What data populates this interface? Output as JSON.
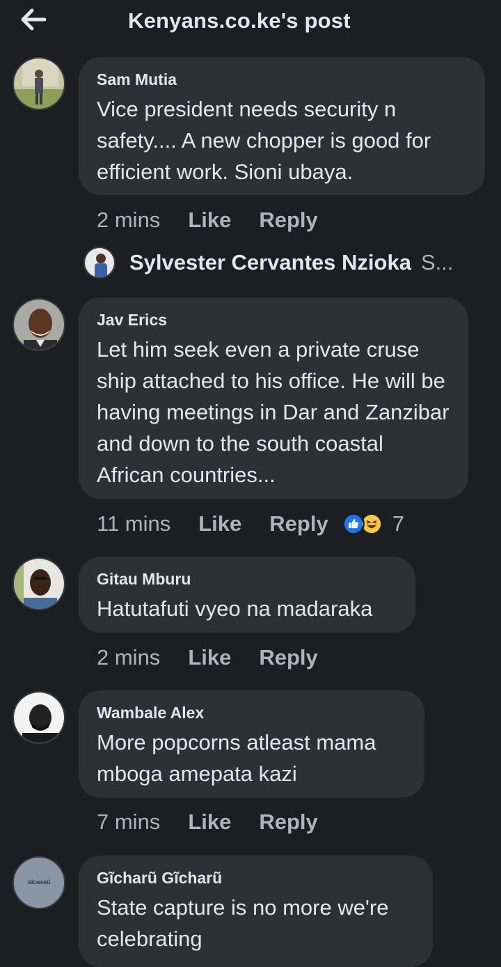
{
  "header": {
    "back_icon": "arrow-left-icon",
    "title": "Kenyans.co.ke's post"
  },
  "comments": [
    {
      "author": "Sam Mutia",
      "text": "Vice president needs security n safety.... A new chopper is good for efficient work. Sioni ubaya.",
      "time": "2 mins",
      "like": "Like",
      "reply": "Reply"
    },
    {
      "author": "Jav Erics",
      "text": "Let him seek even a private cruse ship attached to his office. He will be having meetings in Dar and Zanzibar and down to the south coastal African countries...",
      "time": "11 mins",
      "like": "Like",
      "reply": "Reply",
      "reactions": {
        "icons": [
          "like-reaction-icon",
          "haha-reaction-icon"
        ],
        "count": "7"
      }
    },
    {
      "author": "Gitau Mburu",
      "text": "Hatutafuti vyeo na madaraka",
      "time": "2 mins",
      "like": "Like",
      "reply": "Reply"
    },
    {
      "author": "Wambale Alex",
      "text": "More popcorns atleast mama mboga amepata kazi",
      "time": "7 mins",
      "like": "Like",
      "reply": "Reply"
    },
    {
      "author": "Gĩcharũ Gĩcharũ",
      "text": "State capture is no more we're celebrating",
      "time": "",
      "avatar_text": "GĨCHARŨ"
    }
  ],
  "reply_preview": {
    "author": "Sylvester Cervantes Nzioka",
    "snippet": "S..."
  },
  "colors": {
    "background": "#1d1e21",
    "bubble": "#2f3033",
    "text_primary": "#e4e6eb",
    "text_secondary": "#b0b3b8",
    "like_blue": "#1877f2",
    "haha_yellow": "#f7c94a"
  }
}
